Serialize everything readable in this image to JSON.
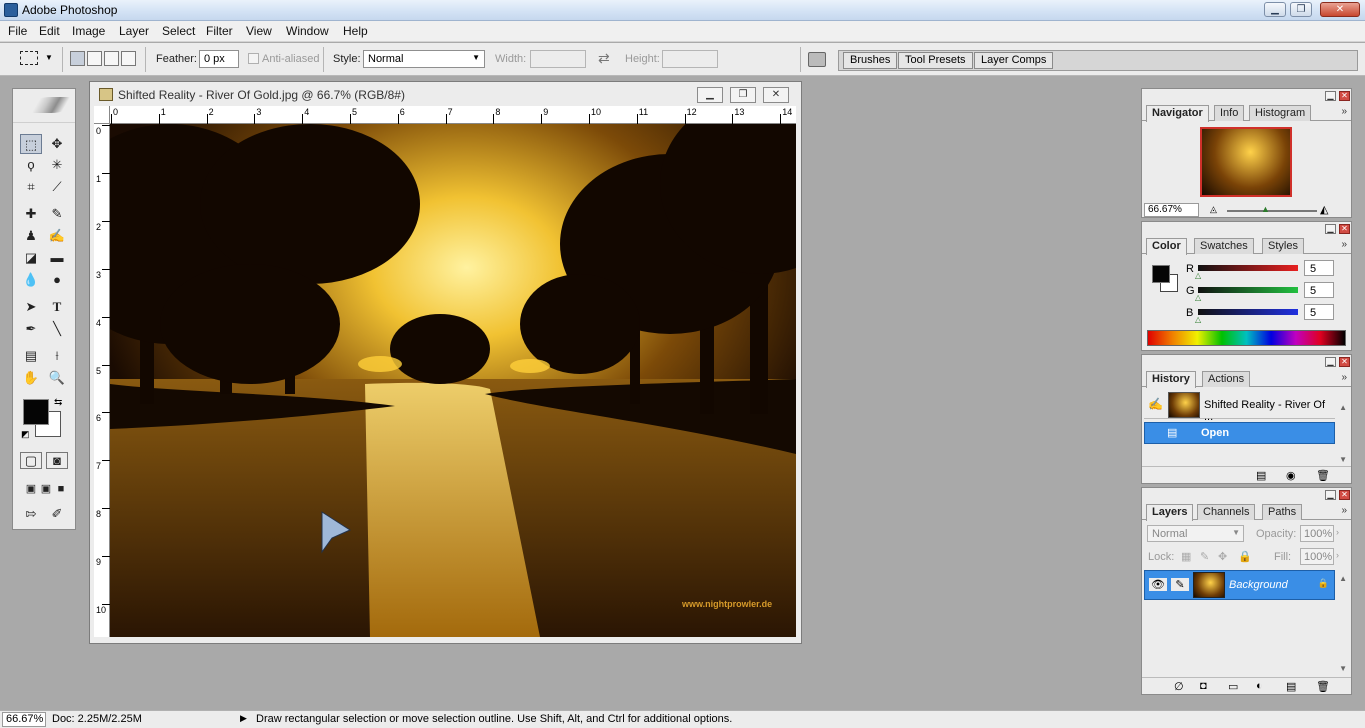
{
  "app": {
    "title": "Adobe Photoshop"
  },
  "window_controls": {
    "minimize": "▁",
    "maximize": "❐",
    "close": "✕"
  },
  "menu": [
    "File",
    "Edit",
    "Image",
    "Layer",
    "Select",
    "Filter",
    "View",
    "Window",
    "Help"
  ],
  "options": {
    "feather_label": "Feather:",
    "feather_value": "0 px",
    "antialiased_label": "Anti-aliased",
    "style_label": "Style:",
    "style_value": "Normal",
    "width_label": "Width:",
    "height_label": "Height:",
    "well_tabs": [
      "Brushes",
      "Tool Presets",
      "Layer Comps"
    ]
  },
  "document": {
    "title": "Shifted Reality - River Of Gold.jpg @ 66.7% (RGB/8#)",
    "ruler_h": [
      "0",
      "1",
      "2",
      "3",
      "4",
      "5",
      "6",
      "7",
      "8",
      "9",
      "10",
      "11",
      "12",
      "13",
      "14"
    ],
    "ruler_v": [
      "0",
      "1",
      "2",
      "3",
      "4",
      "5",
      "6",
      "7",
      "8",
      "9",
      "10"
    ],
    "watermark": "www.nightprowler.de"
  },
  "navigator": {
    "tabs": [
      "Navigator",
      "Info",
      "Histogram"
    ],
    "zoom": "66.67%"
  },
  "color": {
    "tabs": [
      "Color",
      "Swatches",
      "Styles"
    ],
    "channels": [
      {
        "label": "R",
        "value": "5",
        "color": "#c0202a"
      },
      {
        "label": "G",
        "value": "5",
        "color": "#1f9a2d"
      },
      {
        "label": "B",
        "value": "5",
        "color": "#1d27b6"
      }
    ]
  },
  "history": {
    "tabs": [
      "History",
      "Actions"
    ],
    "snapshot_label": "Shifted Reality - River Of ...",
    "steps": [
      "Open"
    ]
  },
  "layers": {
    "tabs": [
      "Layers",
      "Channels",
      "Paths"
    ],
    "blend_mode": "Normal",
    "opacity_label": "Opacity:",
    "opacity_value": "100%",
    "lock_label": "Lock:",
    "fill_label": "Fill:",
    "fill_value": "100%",
    "items": [
      {
        "name": "Background"
      }
    ]
  },
  "status": {
    "zoom": "66.67%",
    "doc": "Doc: 2.25M/2.25M",
    "hint": "Draw rectangular selection or move selection outline.  Use Shift, Alt, and Ctrl for additional options."
  },
  "colors": {
    "accent": "#3a8ee6",
    "foreground": "#050505",
    "background": "#ffffff"
  }
}
